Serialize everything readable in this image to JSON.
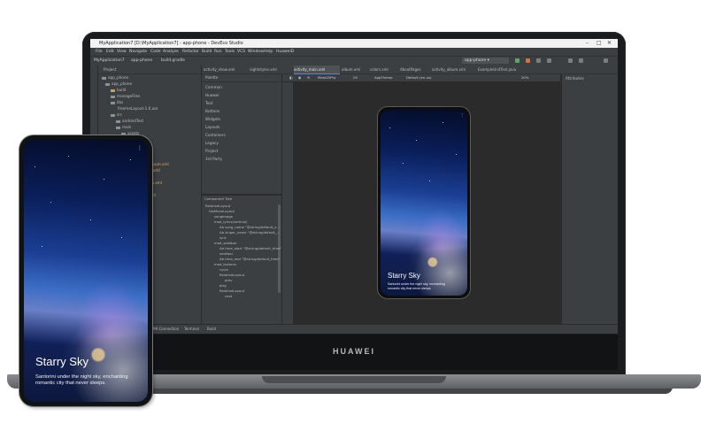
{
  "ide": {
    "window_title": "MyApplication7 [D:\\MyApplication7] - app-phone - DevEco Studio",
    "menu": [
      "File",
      "Edit",
      "View",
      "Navigate",
      "Code",
      "Analyze",
      "Refactor",
      "Build",
      "Run",
      "Tools",
      "VCS",
      "Window",
      "Help",
      "HuaweiD"
    ],
    "breadcrumb": [
      "MyApplication7",
      "app-phone",
      "build.gradle"
    ],
    "run_config": "app-phone",
    "project_header": "Project",
    "project_tree": [
      "app_phone",
      "app_phone",
      "build",
      "manageFiles",
      "libs",
      "freemeLayout-1.0.aar",
      "src",
      "androidTest",
      "main",
      "assets",
      "java",
      "res",
      "graphic",
      "layout",
      "activity_album.xml",
      "...ty_main.xml",
      "...ed.xml",
      "...al_album.xml",
      "...sh.xml",
      "...endor.xml"
    ],
    "tabs": [
      "activity_show.xml",
      "nightstyles.xml",
      "activity_main.xml",
      "album.xml",
      "colors.xml",
      "AboutPages",
      "activity_album.xml",
      "ExampleUnitTest.java"
    ],
    "palette_header": "Palette",
    "palette": [
      "Common",
      "Huawei",
      "Text",
      "Buttons",
      "Widgets",
      "Layouts",
      "Containers",
      "Legacy",
      "Project",
      "3rd Party"
    ],
    "component_tree_header": "Component Tree",
    "component_tree": [
      "RelativeLayout",
      "HwMoveLayout",
      "songImage",
      "mod_lyrics(vertical)",
      "Ab song_name  \"@string/default_s...",
      "Ab singer_name  \"@string/default_...",
      "lyric",
      "mod_seekbar",
      "Ab time_start  \"@string/default_time\"",
      "seekbar",
      "Ab time_end  \"@string/default_time\"",
      "mod_buttons",
      "cycle",
      "RelativeLayout",
      "prev",
      "play",
      "RelativeLayout",
      "next"
    ],
    "design_toolbar": {
      "device": "Mate20Pro",
      "api": "29",
      "theme": "AppTheme",
      "locale": "Default (en-us)",
      "zoom": "20%"
    },
    "attributes_header": "Attributes",
    "status_bar": [
      "HiMA Connection",
      "Terminal",
      "Build"
    ],
    "preview": {
      "title": "Starry Sky",
      "subtitle": "Santorini under the night sky, enchanting romantic city that never sleeps."
    }
  },
  "laptop_brand": "HUAWEI",
  "phone": {
    "title": "Starry Sky",
    "subtitle": "Santorini under the night sky, enchanting romantic city that never sleeps."
  },
  "icons": [
    "folder-icon",
    "run-icon",
    "debug-icon",
    "menu-dots-icon"
  ],
  "colors": {
    "ide_panel": "#3c3f41",
    "ide_editor": "#2b2b2b",
    "accent": "#4a88c7",
    "device_frame": "#111214"
  }
}
